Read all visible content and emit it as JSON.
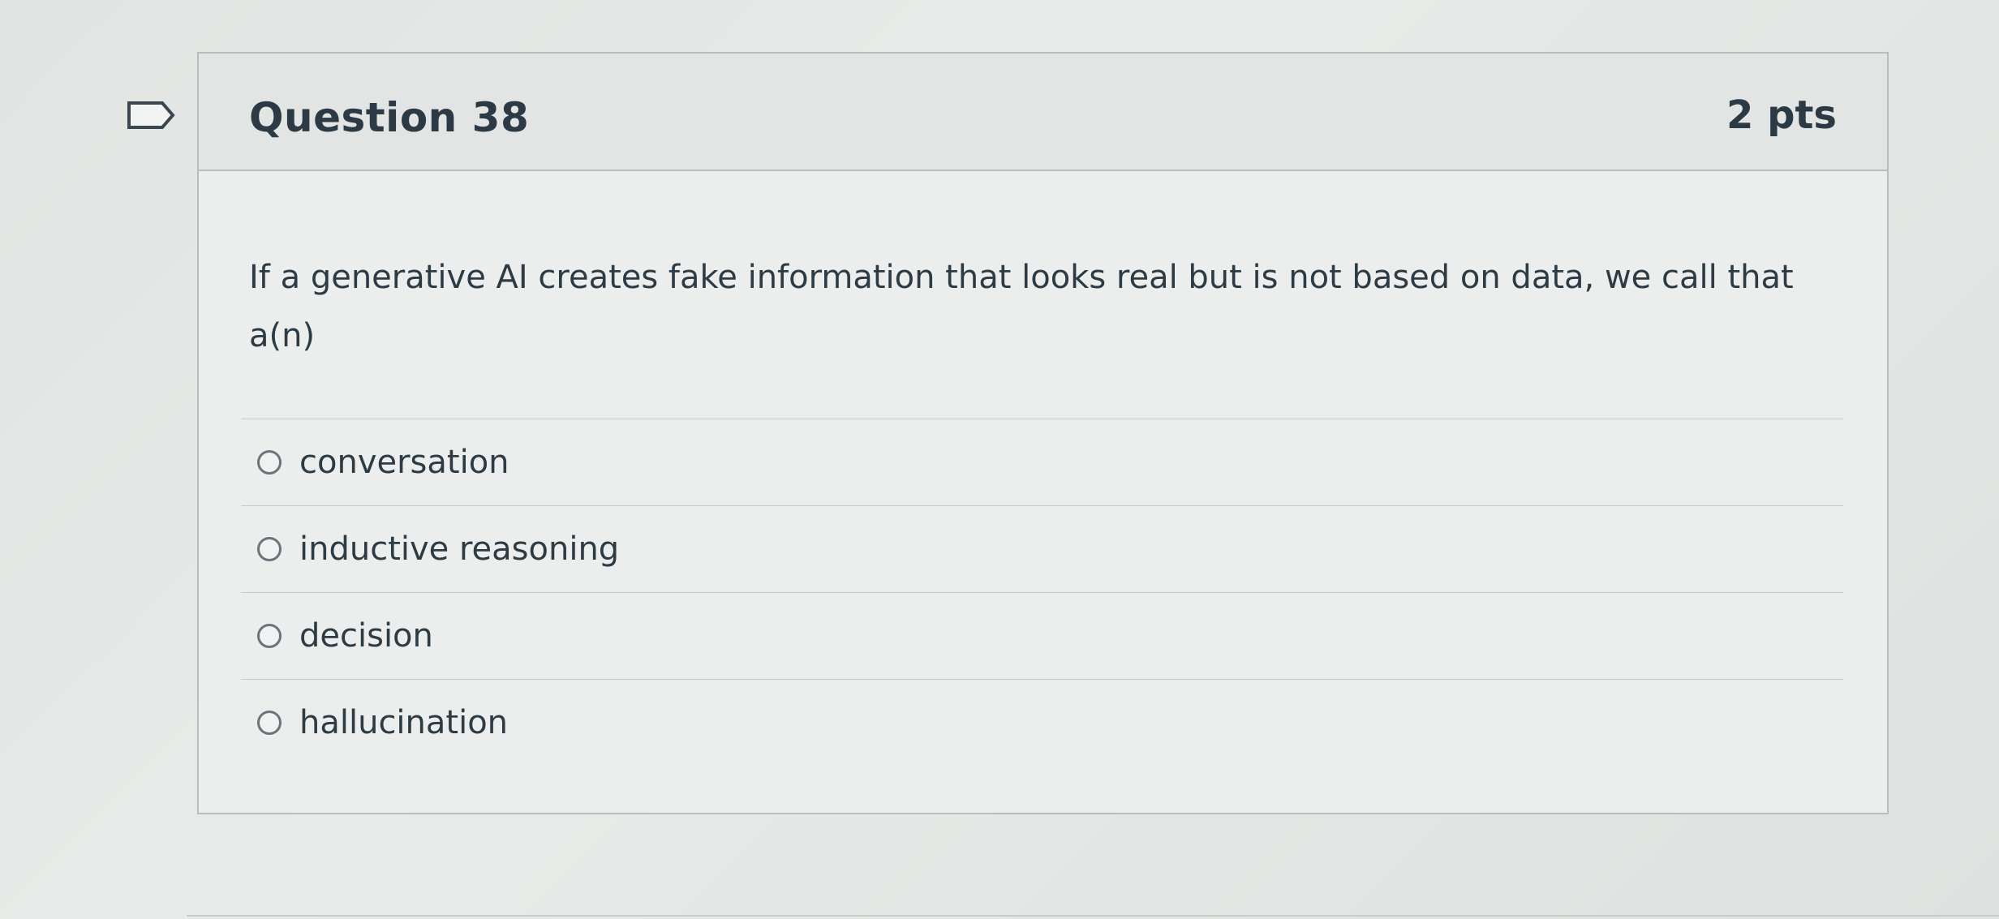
{
  "question": {
    "title": "Question 38",
    "points": "2 pts",
    "text": "If a generative AI creates fake information that looks real but is not based on data, we call that a(n)"
  },
  "answers": [
    {
      "label": "conversation",
      "selected": false
    },
    {
      "label": "inductive reasoning",
      "selected": false
    },
    {
      "label": "decision",
      "selected": false
    },
    {
      "label": "hallucination",
      "selected": false
    }
  ],
  "icons": {
    "flag": "flag-question-icon",
    "radio": "radio-unchecked-icon"
  },
  "colors": {
    "text": "#2d3b45",
    "border": "#b9bdbc",
    "header_bg": "#e3e5e4",
    "card_bg": "#eceeed"
  }
}
